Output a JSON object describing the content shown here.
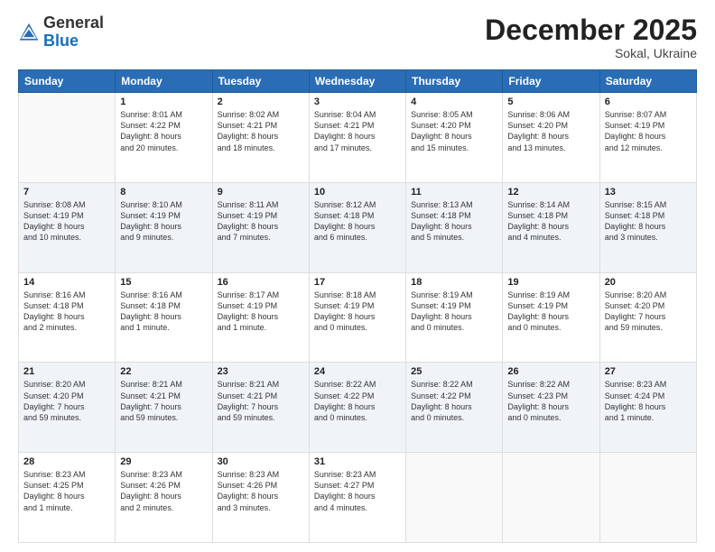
{
  "header": {
    "logo_general": "General",
    "logo_blue": "Blue",
    "month_title": "December 2025",
    "location": "Sokal, Ukraine"
  },
  "days_of_week": [
    "Sunday",
    "Monday",
    "Tuesday",
    "Wednesday",
    "Thursday",
    "Friday",
    "Saturday"
  ],
  "weeks": [
    [
      {
        "day": "",
        "sunrise": "",
        "sunset": "",
        "daylight": "",
        "empty": true
      },
      {
        "day": "1",
        "sunrise": "Sunrise: 8:01 AM",
        "sunset": "Sunset: 4:22 PM",
        "daylight": "Daylight: 8 hours and 20 minutes."
      },
      {
        "day": "2",
        "sunrise": "Sunrise: 8:02 AM",
        "sunset": "Sunset: 4:21 PM",
        "daylight": "Daylight: 8 hours and 18 minutes."
      },
      {
        "day": "3",
        "sunrise": "Sunrise: 8:04 AM",
        "sunset": "Sunset: 4:21 PM",
        "daylight": "Daylight: 8 hours and 17 minutes."
      },
      {
        "day": "4",
        "sunrise": "Sunrise: 8:05 AM",
        "sunset": "Sunset: 4:20 PM",
        "daylight": "Daylight: 8 hours and 15 minutes."
      },
      {
        "day": "5",
        "sunrise": "Sunrise: 8:06 AM",
        "sunset": "Sunset: 4:20 PM",
        "daylight": "Daylight: 8 hours and 13 minutes."
      },
      {
        "day": "6",
        "sunrise": "Sunrise: 8:07 AM",
        "sunset": "Sunset: 4:19 PM",
        "daylight": "Daylight: 8 hours and 12 minutes."
      }
    ],
    [
      {
        "day": "7",
        "sunrise": "Sunrise: 8:08 AM",
        "sunset": "Sunset: 4:19 PM",
        "daylight": "Daylight: 8 hours and 10 minutes."
      },
      {
        "day": "8",
        "sunrise": "Sunrise: 8:10 AM",
        "sunset": "Sunset: 4:19 PM",
        "daylight": "Daylight: 8 hours and 9 minutes."
      },
      {
        "day": "9",
        "sunrise": "Sunrise: 8:11 AM",
        "sunset": "Sunset: 4:19 PM",
        "daylight": "Daylight: 8 hours and 7 minutes."
      },
      {
        "day": "10",
        "sunrise": "Sunrise: 8:12 AM",
        "sunset": "Sunset: 4:18 PM",
        "daylight": "Daylight: 8 hours and 6 minutes."
      },
      {
        "day": "11",
        "sunrise": "Sunrise: 8:13 AM",
        "sunset": "Sunset: 4:18 PM",
        "daylight": "Daylight: 8 hours and 5 minutes."
      },
      {
        "day": "12",
        "sunrise": "Sunrise: 8:14 AM",
        "sunset": "Sunset: 4:18 PM",
        "daylight": "Daylight: 8 hours and 4 minutes."
      },
      {
        "day": "13",
        "sunrise": "Sunrise: 8:15 AM",
        "sunset": "Sunset: 4:18 PM",
        "daylight": "Daylight: 8 hours and 3 minutes."
      }
    ],
    [
      {
        "day": "14",
        "sunrise": "Sunrise: 8:16 AM",
        "sunset": "Sunset: 4:18 PM",
        "daylight": "Daylight: 8 hours and 2 minutes."
      },
      {
        "day": "15",
        "sunrise": "Sunrise: 8:16 AM",
        "sunset": "Sunset: 4:18 PM",
        "daylight": "Daylight: 8 hours and 1 minute."
      },
      {
        "day": "16",
        "sunrise": "Sunrise: 8:17 AM",
        "sunset": "Sunset: 4:19 PM",
        "daylight": "Daylight: 8 hours and 1 minute."
      },
      {
        "day": "17",
        "sunrise": "Sunrise: 8:18 AM",
        "sunset": "Sunset: 4:19 PM",
        "daylight": "Daylight: 8 hours and 0 minutes."
      },
      {
        "day": "18",
        "sunrise": "Sunrise: 8:19 AM",
        "sunset": "Sunset: 4:19 PM",
        "daylight": "Daylight: 8 hours and 0 minutes."
      },
      {
        "day": "19",
        "sunrise": "Sunrise: 8:19 AM",
        "sunset": "Sunset: 4:19 PM",
        "daylight": "Daylight: 8 hours and 0 minutes."
      },
      {
        "day": "20",
        "sunrise": "Sunrise: 8:20 AM",
        "sunset": "Sunset: 4:20 PM",
        "daylight": "Daylight: 7 hours and 59 minutes."
      }
    ],
    [
      {
        "day": "21",
        "sunrise": "Sunrise: 8:20 AM",
        "sunset": "Sunset: 4:20 PM",
        "daylight": "Daylight: 7 hours and 59 minutes."
      },
      {
        "day": "22",
        "sunrise": "Sunrise: 8:21 AM",
        "sunset": "Sunset: 4:21 PM",
        "daylight": "Daylight: 7 hours and 59 minutes."
      },
      {
        "day": "23",
        "sunrise": "Sunrise: 8:21 AM",
        "sunset": "Sunset: 4:21 PM",
        "daylight": "Daylight: 7 hours and 59 minutes."
      },
      {
        "day": "24",
        "sunrise": "Sunrise: 8:22 AM",
        "sunset": "Sunset: 4:22 PM",
        "daylight": "Daylight: 8 hours and 0 minutes."
      },
      {
        "day": "25",
        "sunrise": "Sunrise: 8:22 AM",
        "sunset": "Sunset: 4:22 PM",
        "daylight": "Daylight: 8 hours and 0 minutes."
      },
      {
        "day": "26",
        "sunrise": "Sunrise: 8:22 AM",
        "sunset": "Sunset: 4:23 PM",
        "daylight": "Daylight: 8 hours and 0 minutes."
      },
      {
        "day": "27",
        "sunrise": "Sunrise: 8:23 AM",
        "sunset": "Sunset: 4:24 PM",
        "daylight": "Daylight: 8 hours and 1 minute."
      }
    ],
    [
      {
        "day": "28",
        "sunrise": "Sunrise: 8:23 AM",
        "sunset": "Sunset: 4:25 PM",
        "daylight": "Daylight: 8 hours and 1 minute."
      },
      {
        "day": "29",
        "sunrise": "Sunrise: 8:23 AM",
        "sunset": "Sunset: 4:26 PM",
        "daylight": "Daylight: 8 hours and 2 minutes."
      },
      {
        "day": "30",
        "sunrise": "Sunrise: 8:23 AM",
        "sunset": "Sunset: 4:26 PM",
        "daylight": "Daylight: 8 hours and 3 minutes."
      },
      {
        "day": "31",
        "sunrise": "Sunrise: 8:23 AM",
        "sunset": "Sunset: 4:27 PM",
        "daylight": "Daylight: 8 hours and 4 minutes."
      },
      {
        "day": "",
        "sunrise": "",
        "sunset": "",
        "daylight": "",
        "empty": true
      },
      {
        "day": "",
        "sunrise": "",
        "sunset": "",
        "daylight": "",
        "empty": true
      },
      {
        "day": "",
        "sunrise": "",
        "sunset": "",
        "daylight": "",
        "empty": true
      }
    ]
  ]
}
